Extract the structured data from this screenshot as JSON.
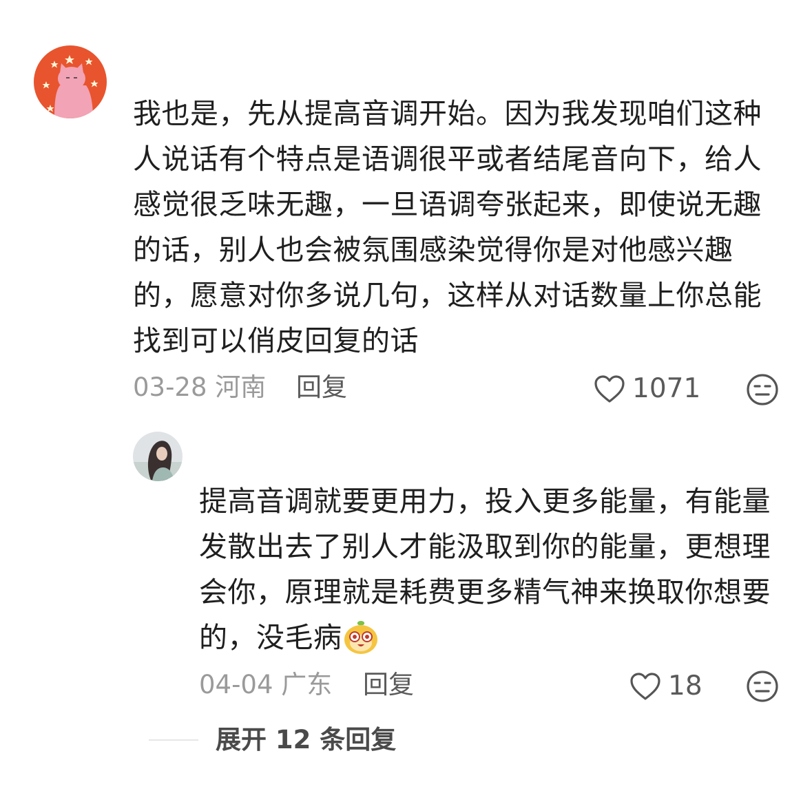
{
  "comment": {
    "text": "我也是，先从提高音调开始。因为我发现咱们这种人说话有个特点是语调很平或者结尾音向下，给人感觉很乏味无趣，一旦语调夸张起来，即使说无趣的话，别人也会被氛围感染觉得你是对他感兴趣的，愿意对你多说几句，这样从对话数量上你总能找到可以俏皮回复的话",
    "date": "03-28",
    "location": "河南",
    "reply_label": "回复",
    "likes": "1071",
    "avatar_icon": "pink-cat-avatar",
    "avatar_bg": "#e8542e"
  },
  "reply": {
    "text": "提高音调就要更用力，投入更多能量，有能量发散出去了别人才能汲取到你的能量，更想理会你，原理就是耗费更多精气神来换取你想要的，没毛病",
    "emoji": "smile-emoji",
    "date": "04-04",
    "location": "广东",
    "reply_label": "回复",
    "likes": "18",
    "avatar_icon": "girl-photo-avatar"
  },
  "expand": {
    "label": "展开 12 条回复"
  },
  "icons": {
    "like": "heart-icon",
    "dislike": "meh-face-icon"
  }
}
